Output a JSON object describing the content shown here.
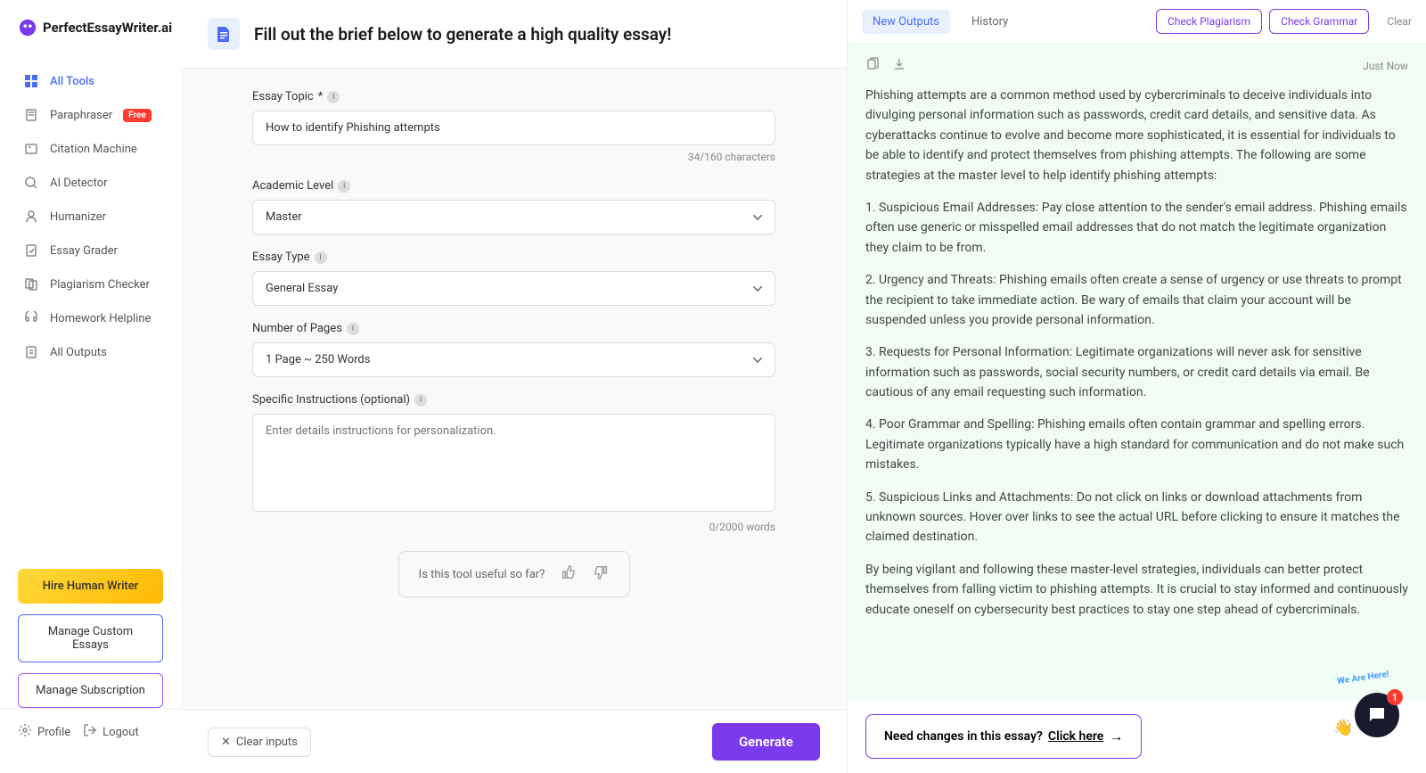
{
  "brand": "PerfectEssayWriter.ai",
  "sidebar": {
    "items": [
      {
        "label": "All Tools",
        "icon": "grid-icon",
        "active": true
      },
      {
        "label": "Paraphraser",
        "icon": "document-icon",
        "badge": "Free"
      },
      {
        "label": "Citation Machine",
        "icon": "citation-icon"
      },
      {
        "label": "AI Detector",
        "icon": "detector-icon"
      },
      {
        "label": "Humanizer",
        "icon": "humanizer-icon"
      },
      {
        "label": "Essay Grader",
        "icon": "grader-icon"
      },
      {
        "label": "Plagiarism Checker",
        "icon": "plagiarism-icon"
      },
      {
        "label": "Homework Helpline",
        "icon": "homework-icon"
      },
      {
        "label": "All Outputs",
        "icon": "outputs-icon"
      }
    ],
    "hire_btn": "Hire Human Writer",
    "manage_essays_btn": "Manage Custom Essays",
    "manage_sub_btn": "Manage Subscription",
    "profile": "Profile",
    "logout": "Logout"
  },
  "main": {
    "title": "Fill out the brief below to generate a high quality essay!",
    "form": {
      "topic_label": "Essay Topic",
      "topic_value": "How to identify Phishing attempts",
      "topic_count": "34/160 characters",
      "level_label": "Academic Level",
      "level_value": "Master",
      "type_label": "Essay Type",
      "type_value": "General Essay",
      "pages_label": "Number of Pages",
      "pages_value": "1 Page ~ 250 Words",
      "instructions_label": "Specific Instructions (optional)",
      "instructions_placeholder": "Enter details instructions for personalization.",
      "instructions_count": "0/2000 words"
    },
    "feedback": {
      "prompt": "Is this tool useful so far?"
    },
    "footer": {
      "clear": "Clear inputs",
      "generate": "Generate"
    }
  },
  "output": {
    "tabs": {
      "new": "New Outputs",
      "history": "History"
    },
    "check_plag": "Check Plagiarism",
    "check_gram": "Check Grammar",
    "clear": "Clear",
    "timestamp": "Just Now",
    "essay_p1": "Phishing attempts are a common method used by cybercriminals to deceive individuals into divulging personal information such as passwords, credit card details, and sensitive data. As cyberattacks continue to evolve and become more sophisticated, it is essential for individuals to be able to identify and protect themselves from phishing attempts. The following are some strategies at the master level to help identify phishing attempts:",
    "essay_p2": "1. Suspicious Email Addresses: Pay close attention to the sender's email address. Phishing emails often use generic or misspelled email addresses that do not match the legitimate organization they claim to be from.",
    "essay_p3": "2. Urgency and Threats: Phishing emails often create a sense of urgency or use threats to prompt the recipient to take immediate action. Be wary of emails that claim your account will be suspended unless you provide personal information.",
    "essay_p4": "3. Requests for Personal Information: Legitimate organizations will never ask for sensitive information such as passwords, social security numbers, or credit card details via email. Be cautious of any email requesting such information.",
    "essay_p5": "4. Poor Grammar and Spelling: Phishing emails often contain grammar and spelling errors. Legitimate organizations typically have a high standard for communication and do not make such mistakes.",
    "essay_p6": "5. Suspicious Links and Attachments: Do not click on links or download attachments from unknown sources. Hover over links to see the actual URL before clicking to ensure it matches the claimed destination.",
    "essay_p7": "By being vigilant and following these master-level strategies, individuals can better protect themselves from falling victim to phishing attempts. It is crucial to stay informed and continuously educate oneself on cybersecurity best practices to stay one step ahead of cybercriminals.",
    "changes_prompt": "Need changes in this essay? ",
    "changes_link": "Click here"
  },
  "chat": {
    "banner": "We Are Here!",
    "badge": "1"
  }
}
